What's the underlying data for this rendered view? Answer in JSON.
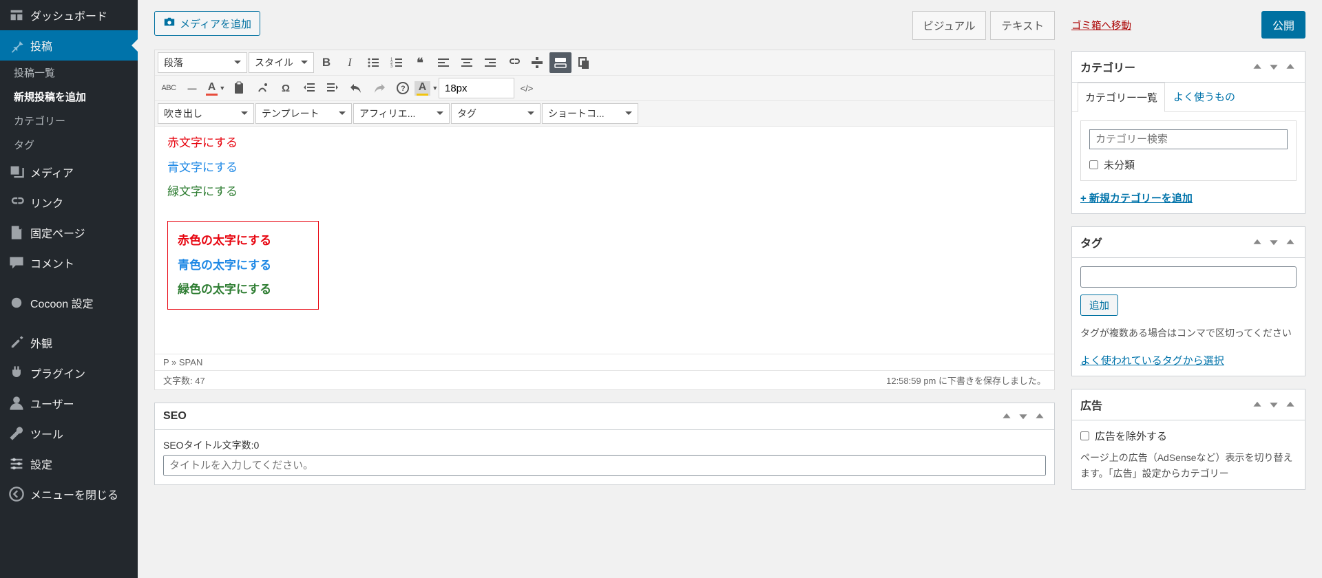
{
  "sidebar": {
    "dashboard": "ダッシュボード",
    "posts": "投稿",
    "posts_sub": {
      "list": "投稿一覧",
      "new": "新規投稿を追加",
      "categories": "カテゴリー",
      "tags": "タグ"
    },
    "media": "メディア",
    "links": "リンク",
    "pages": "固定ページ",
    "comments": "コメント",
    "cocoon": "Cocoon 設定",
    "appearance": "外観",
    "plugins": "プラグイン",
    "users": "ユーザー",
    "tools": "ツール",
    "settings": "設定",
    "collapse": "メニューを閉じる"
  },
  "editor": {
    "add_media": "メディアを追加",
    "tabs": {
      "visual": "ビジュアル",
      "text": "テキスト"
    },
    "toolbar": {
      "format": "段落",
      "style": "スタイル",
      "fontsize": "18px",
      "balloon": "吹き出し",
      "template": "テンプレート",
      "affiliate": "アフィリエ...",
      "tag": "タグ",
      "shortcode": "ショートコ..."
    },
    "content": {
      "l1": "赤文字にする",
      "l2": "青文字にする",
      "l3": "緑文字にする",
      "b1": "赤色の太字にする",
      "b2": "青色の太字にする",
      "b3": "緑色の太字にする"
    },
    "path": "P » SPAN",
    "wordcount": "文字数: 47",
    "status": "12:58:59 pm に下書きを保存しました。"
  },
  "seo": {
    "title": "SEO",
    "title_count": "SEOタイトル文字数:0",
    "title_placeholder": "タイトルを入力してください。"
  },
  "right": {
    "trash": "ゴミ箱へ移動",
    "publish": "公開",
    "category": {
      "heading": "カテゴリー",
      "tab_all": "カテゴリー一覧",
      "tab_freq": "よく使うもの",
      "search_placeholder": "カテゴリー検索",
      "uncat": "未分類",
      "add_new": "+ 新規カテゴリーを追加"
    },
    "tag": {
      "heading": "タグ",
      "add": "追加",
      "hint": "タグが複数ある場合はコンマで区切ってください",
      "popular": "よく使われているタグから選択"
    },
    "ad": {
      "heading": "広告",
      "exclude": "広告を除外する",
      "desc": "ページ上の広告（AdSenseなど）表示を切り替えます。「広告」設定からカテゴリー"
    }
  }
}
